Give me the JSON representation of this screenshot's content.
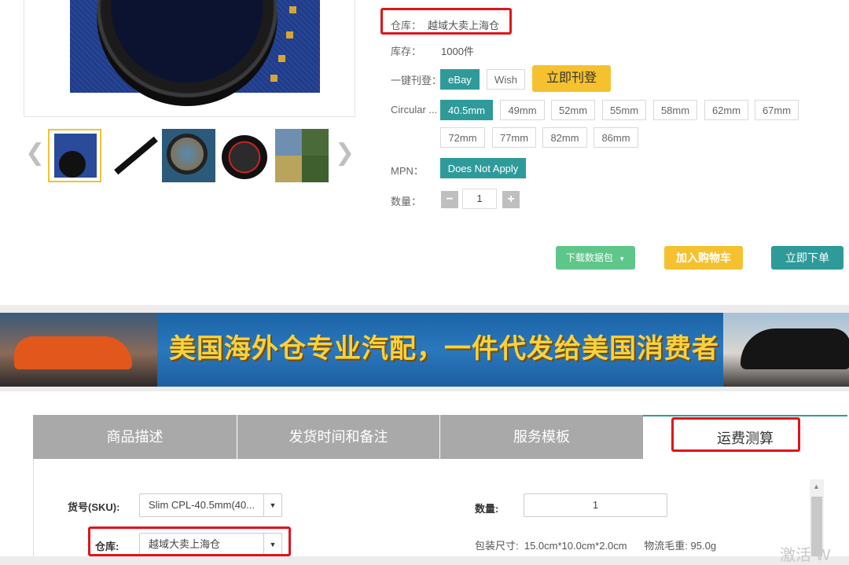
{
  "product": {
    "warehouse_label": "仓库：",
    "warehouse_value": "越域大卖上海仓",
    "stock_label": "库存：",
    "stock_value": "1000件",
    "publish_label": "一键刊登：",
    "platforms": [
      "eBay",
      "Wish"
    ],
    "publish_button": "立即刊登",
    "size_label": "Circular ...",
    "sizes": [
      "40.5mm",
      "49mm",
      "52mm",
      "55mm",
      "58mm",
      "62mm",
      "67mm",
      "72mm",
      "77mm",
      "82mm",
      "86mm"
    ],
    "selected_size": "40.5mm",
    "mpn_label": "MPN：",
    "mpn_value": "Does Not Apply",
    "quantity_label": "数量：",
    "quantity_value": "1",
    "minus": "−",
    "plus": "+",
    "download_button": "下载数据包",
    "cart_button": "加入购物车",
    "order_button": "立即下单",
    "gallery_prev": "❮",
    "gallery_next": "❯"
  },
  "banner": {
    "text": "美国海外仓专业汽配，一件代发给美国消费者"
  },
  "tabs": [
    {
      "label": "商品描述"
    },
    {
      "label": "发货时间和备注"
    },
    {
      "label": "服务模板"
    },
    {
      "label": "运费测算"
    }
  ],
  "calc": {
    "sku_label": "货号(SKU):",
    "sku_value": "Slim CPL-40.5mm(40...",
    "warehouse_label": "仓库:",
    "warehouse_value": "越域大卖上海仓",
    "qty_label": "数量:",
    "qty_value": "1",
    "package_text": "包装尺寸:  15.0cm*10.0cm*2.0cm      物流毛重: 95.0g"
  },
  "watermark": "激活 W",
  "colors": {
    "accent": "#2f9a9a",
    "yellow": "#f5c12e",
    "highlight": "#e0141b",
    "green": "#5fc68a"
  }
}
